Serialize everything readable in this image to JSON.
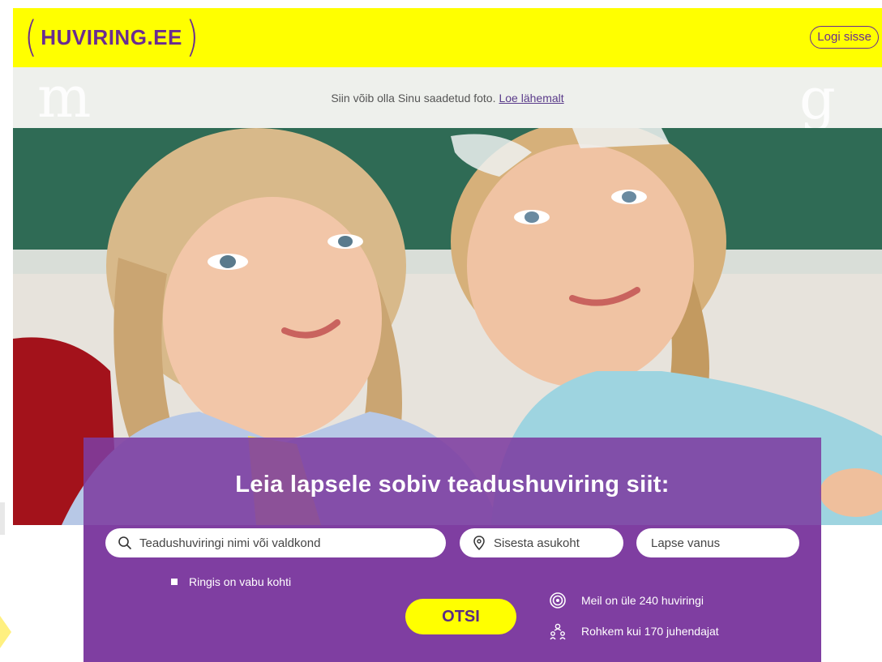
{
  "header": {
    "logo_text": "HUVIRING.EE",
    "login_label": "Logi sisse"
  },
  "notice": {
    "text": "Siin võib olla Sinu saadetud foto.",
    "link_label": "Loe lähemalt"
  },
  "search": {
    "title": "Leia lapsele sobiv teadushuviring siit:",
    "name_placeholder": "Teadushuviringi nimi või valdkond",
    "location_placeholder": "Sisesta asukoht",
    "age_placeholder": "Lapse vanus",
    "checkbox_label": "Ringis on vabu kohti",
    "submit_label": "OTSI"
  },
  "stats": [
    {
      "icon": "target-icon",
      "text": "Meil on üle 240 huviringi"
    },
    {
      "icon": "people-icon",
      "text": "Rohkem kui 170 juhendajat"
    }
  ],
  "colors": {
    "brand_yellow": "#ffff00",
    "brand_purple": "#6a2c91",
    "panel_purple": "#8a4fa7"
  }
}
